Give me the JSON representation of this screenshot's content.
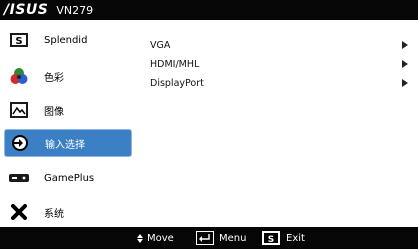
{
  "header": {
    "brand": "/ISUS",
    "model": "VN279"
  },
  "sidebar": {
    "items": [
      {
        "label": "Splendid",
        "icon": "splendid-s-icon"
      },
      {
        "label": "色彩",
        "icon": "color-icon"
      },
      {
        "label": "图像",
        "icon": "image-icon"
      },
      {
        "label": "输入选择",
        "icon": "input-select-icon",
        "selected": true
      },
      {
        "label": "GamePlus",
        "icon": "gameplus-icon"
      },
      {
        "label": "系统",
        "icon": "system-tools-icon"
      }
    ]
  },
  "panel": {
    "options": [
      {
        "label": "VGA"
      },
      {
        "label": "HDMI/MHL"
      },
      {
        "label": "DisplayPort"
      }
    ]
  },
  "footer": {
    "move_label": "Move",
    "menu_label": "Menu",
    "exit_label": "Exit"
  },
  "colors": {
    "header_bg": "#060606",
    "selected_bg": "#3b7fc4",
    "panel_bg": "#ffffff"
  }
}
